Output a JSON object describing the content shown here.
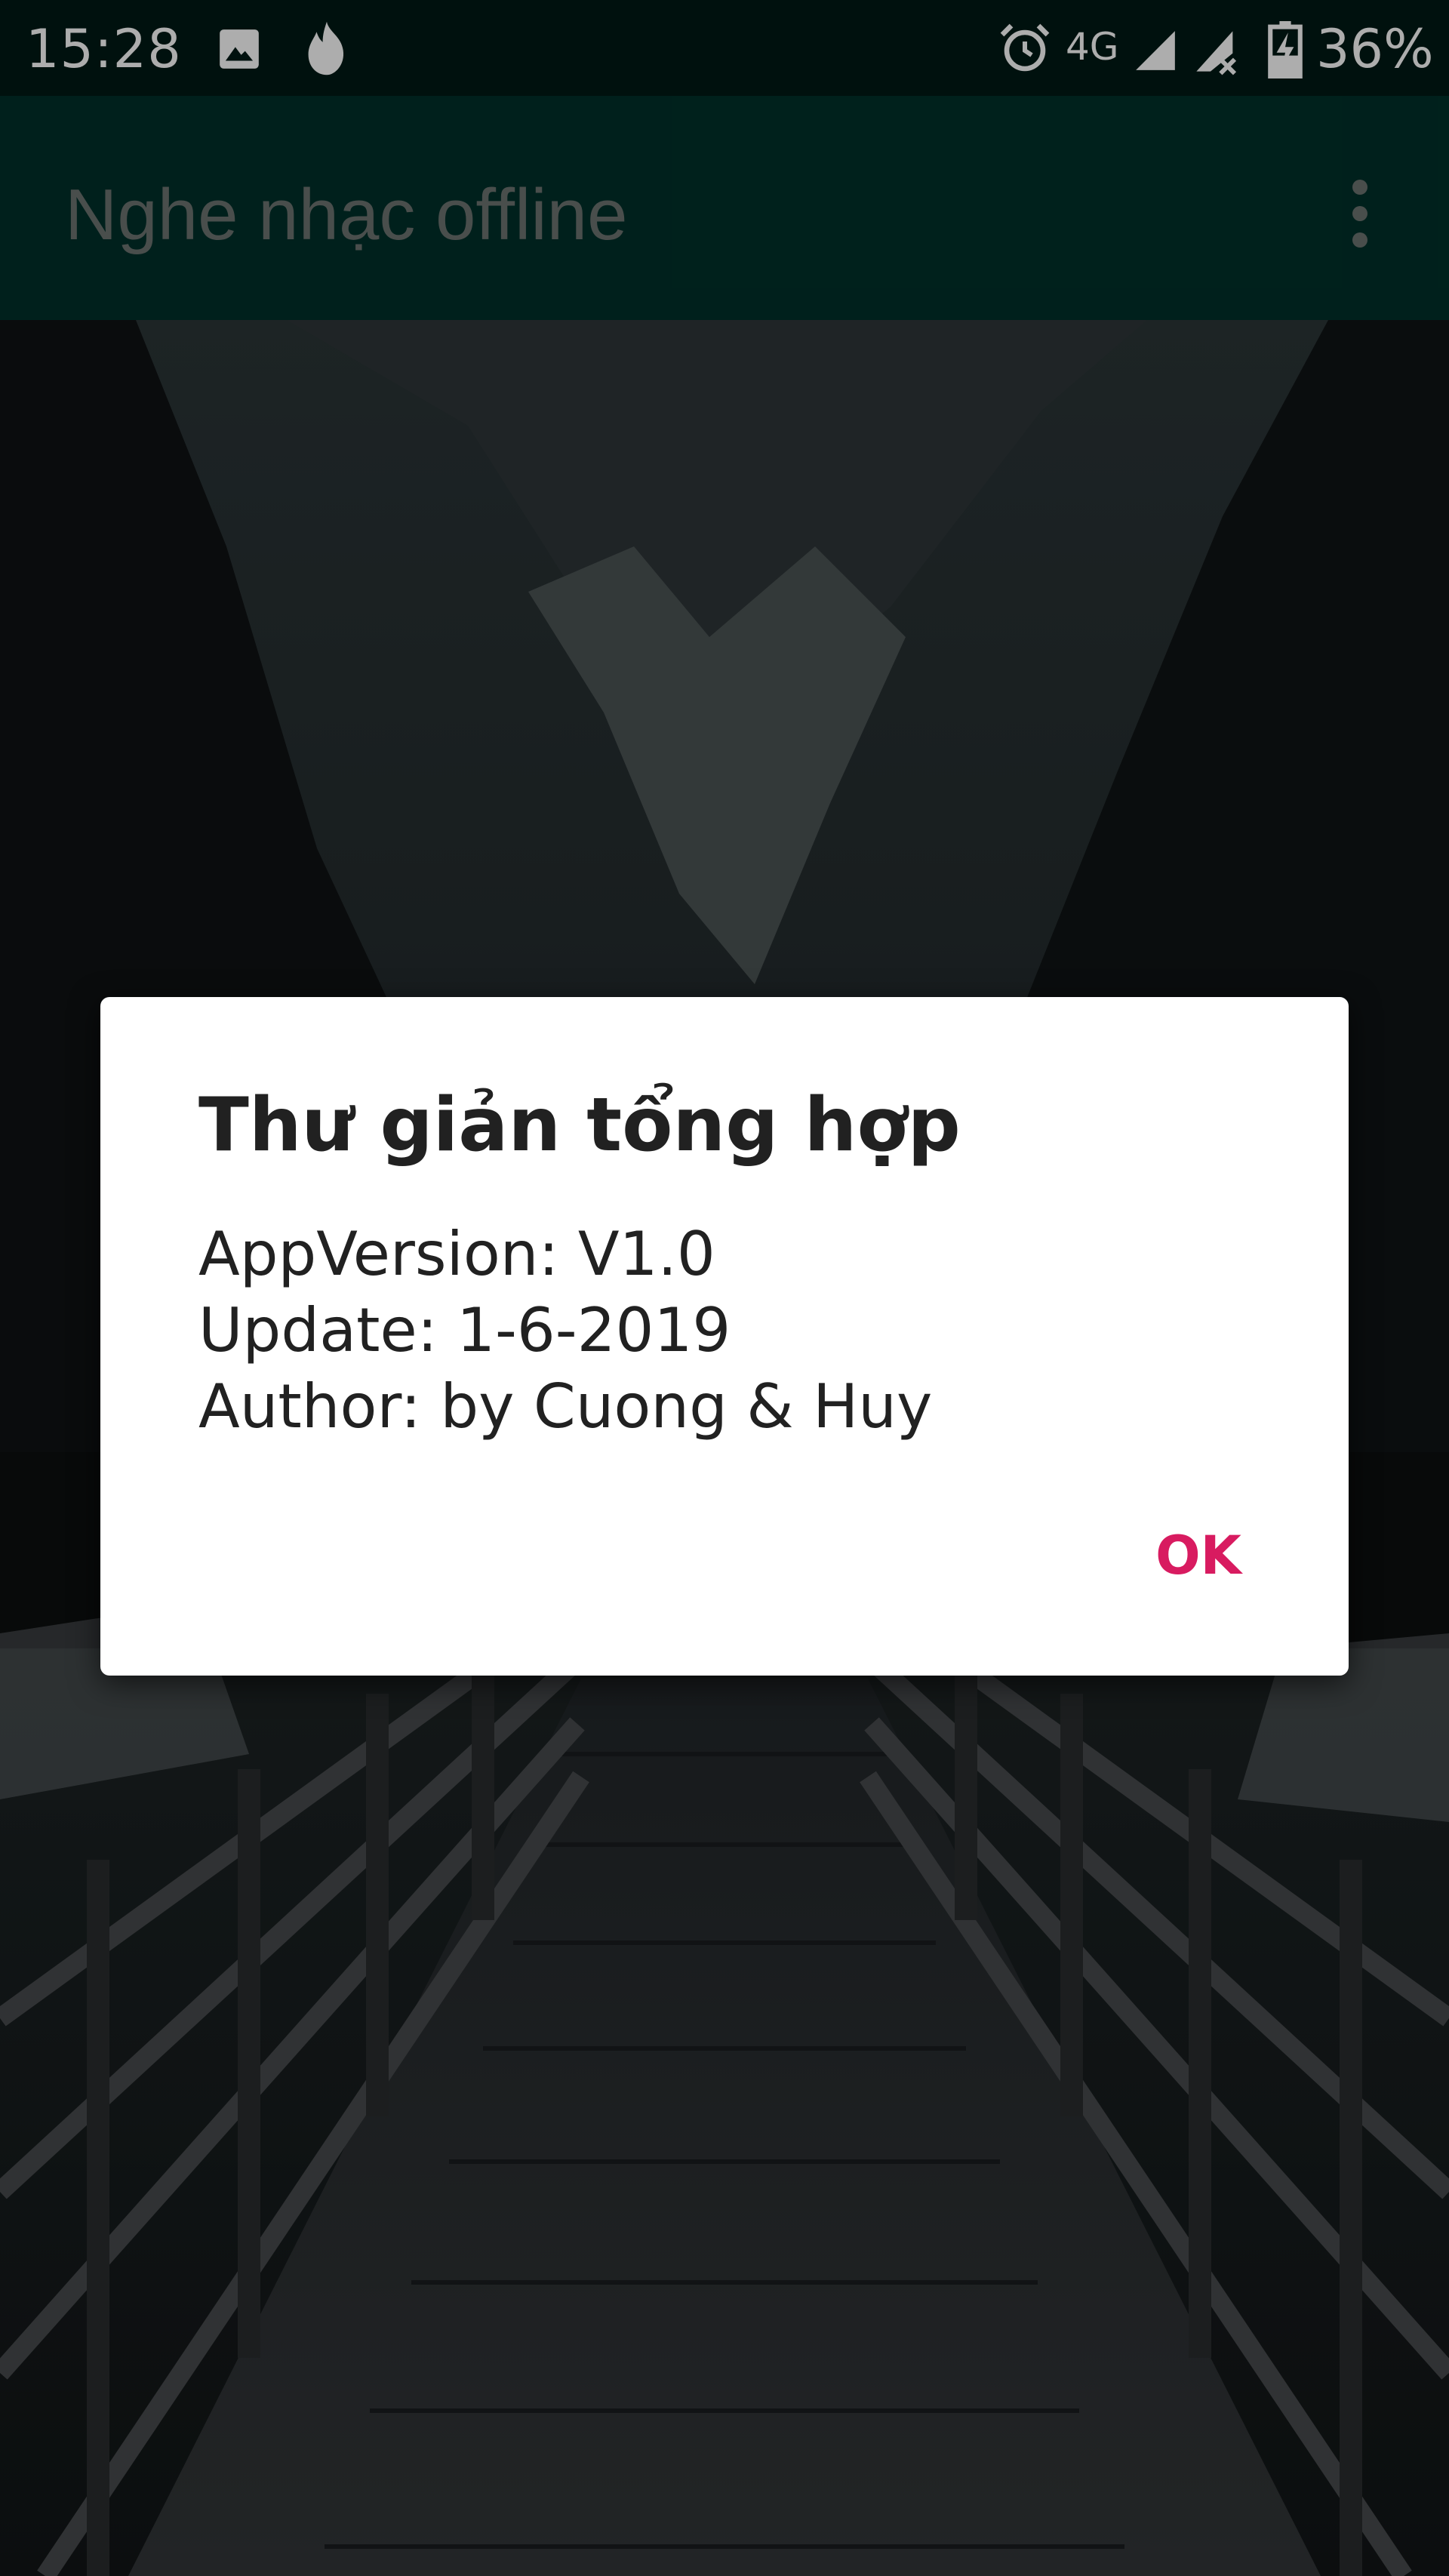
{
  "status_bar": {
    "time": "15:28",
    "network": "4G",
    "battery": "36%",
    "icons": [
      "gallery-icon",
      "fire-icon",
      "alarm-icon",
      "signal-icon",
      "signal-no-data-icon",
      "battery-charging-icon"
    ]
  },
  "app_bar": {
    "title": "Nghe nhạc offline",
    "menu_icon": "more-vert-icon"
  },
  "dialog": {
    "title": "Thư giản tổng hợp",
    "lines": [
      "AppVersion: V1.0",
      "Update: 1-6-2019",
      "Author: by Cuong & Huy"
    ],
    "ok_label": "OK"
  },
  "colors": {
    "status_bar": "#001a16",
    "app_bar": "#00302a",
    "app_title": "#6c7371",
    "accent": "#d81b60",
    "dialog_text": "#212121"
  }
}
